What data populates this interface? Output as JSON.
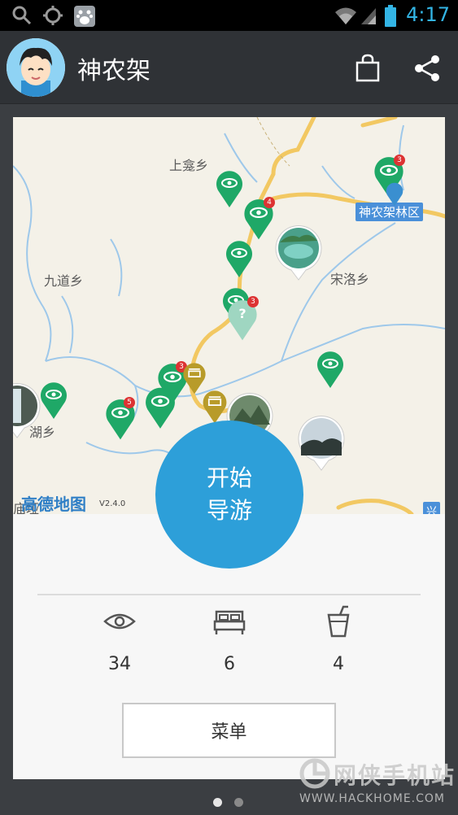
{
  "status_bar": {
    "time": "4:17"
  },
  "header": {
    "title": "神农架"
  },
  "map": {
    "labels": {
      "shangkan": "上龛乡",
      "jiudao": "九道乡",
      "songluo": "宋洛乡",
      "hu": "湖乡",
      "fu": "庙垭"
    },
    "tag_forest": "神农架林区",
    "tag_edge": "兴",
    "brand": "高德地图",
    "brand_version": "V2.4.0",
    "badges": {
      "a": "3",
      "b": "4",
      "c": "3",
      "d": "3",
      "e": "5"
    },
    "question": "?"
  },
  "start_button": {
    "line1": "开始",
    "line2": "导游"
  },
  "stats": {
    "sights": {
      "icon": "eye-icon",
      "value": "34"
    },
    "hotels": {
      "icon": "bed-icon",
      "value": "6"
    },
    "food": {
      "icon": "drink-icon",
      "value": "4"
    }
  },
  "menu_button": "菜单",
  "watermark": {
    "cn": "网侠手机站",
    "url": "WWW.HACKHOME.COM"
  },
  "colors": {
    "accent": "#2d9fd9",
    "pin_green": "#1fa867",
    "pin_gold": "#b89b2a",
    "header": "#2f3236"
  }
}
